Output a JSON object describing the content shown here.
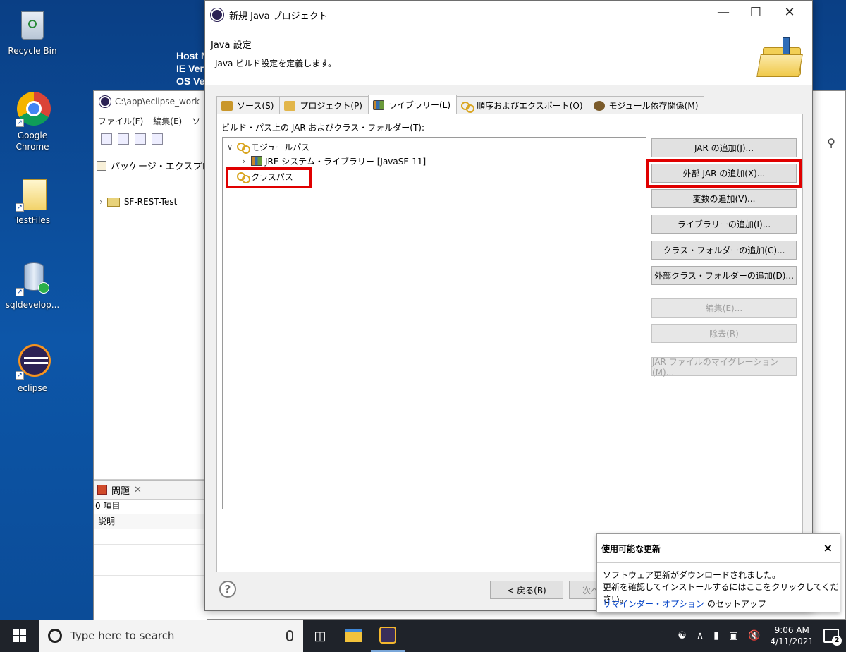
{
  "desktop": {
    "icons": [
      {
        "label": "Recycle Bin"
      },
      {
        "label": "Google Chrome"
      },
      {
        "label": "TestFiles"
      },
      {
        "label": "sqldevelop..."
      },
      {
        "label": "eclipse"
      }
    ],
    "bg_info": [
      "Host N",
      "IE Ver",
      "OS Ve"
    ]
  },
  "eclipse": {
    "title": "C:\\app\\eclipse_work",
    "menu": [
      "ファイル(F)",
      "編集(E)",
      "ソ"
    ],
    "package_explorer": "パッケージ・エクスプロー",
    "project": "SF-REST-Test",
    "problems_tab": "問題",
    "problems_count": "0 項目",
    "problems_header": "説明"
  },
  "dialog": {
    "title": "新規 Java プロジェクト",
    "header_title": "Java 設定",
    "header_desc": "Java ビルド設定を定義します。",
    "tabs": [
      {
        "label": "ソース(S)",
        "active": false,
        "color": "#c9972b"
      },
      {
        "label": "プロジェクト(P)",
        "active": false,
        "color": "#e2b64a"
      },
      {
        "label": "ライブラリー(L)",
        "active": true,
        "color": "#5a7fb0"
      },
      {
        "label": "順序およびエクスポート(O)",
        "active": false,
        "color": "#d9a520"
      },
      {
        "label": "モジュール依存関係(M)",
        "active": false,
        "color": "#7a5a2a"
      }
    ],
    "panel_label": "ビルド・パス上の JAR およびクラス・フォルダー(T):",
    "tree": {
      "module_path": "モジュールパス",
      "jre": "JRE システム・ライブラリー [JavaSE-11]",
      "classpath": "クラスパス"
    },
    "buttons": {
      "add_jar": "JAR の追加(J)...",
      "add_external_jar": "外部 JAR の追加(X)...",
      "add_variable": "変数の追加(V)...",
      "add_library": "ライブラリーの追加(I)...",
      "add_class_folder": "クラス・フォルダーの追加(C)...",
      "add_external_class_folder": "外部クラス・フォルダーの追加(D)...",
      "edit": "編集(E)...",
      "remove": "除去(R)",
      "migrate_jar": "JAR ファイルのマイグレーション(M)..."
    },
    "footer": {
      "help": "?",
      "back": "< 戻る(B)",
      "next": "次へ"
    }
  },
  "notification": {
    "title": "使用可能な更新",
    "close": "×",
    "line1": "ソフトウェア更新がダウンロードされました。",
    "line2": "更新を確認してインストールするにはここをクリックしてください。",
    "link": "リマインダー・オプション",
    "link_suffix": " のセットアップ"
  },
  "taskbar": {
    "search_placeholder": "Type here to search",
    "time": "9:06 AM",
    "date": "4/11/2021",
    "notification_count": "2"
  }
}
